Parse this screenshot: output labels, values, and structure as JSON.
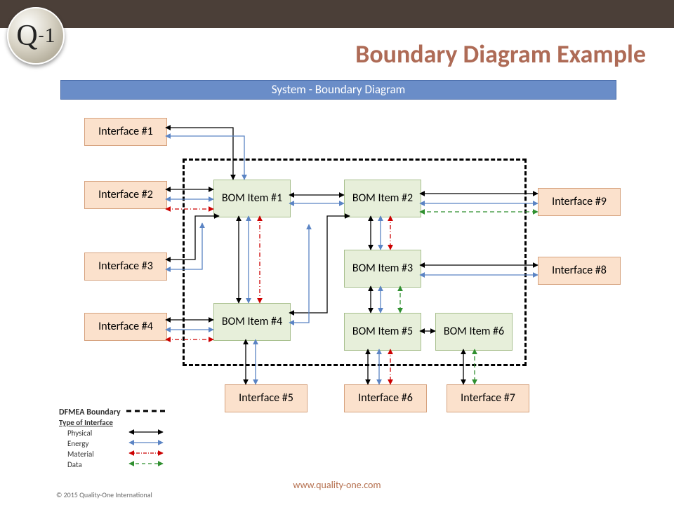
{
  "logo": {
    "q": "Q",
    "dash": "-",
    "one": "1"
  },
  "title": "Boundary Diagram Example",
  "banner": "System - Boundary Diagram",
  "interfaces": {
    "i1": "Interface #1",
    "i2": "Interface #2",
    "i3": "Interface #3",
    "i4": "Interface #4",
    "i5": "Interface #5",
    "i6": "Interface #6",
    "i7": "Interface #7",
    "i8": "Interface #8",
    "i9": "Interface #9"
  },
  "bom": {
    "b1": "BOM Item #1",
    "b2": "BOM Item #2",
    "b3": "BOM Item #3",
    "b4": "BOM Item #4",
    "b5": "BOM Item #5",
    "b6": "BOM Item #6"
  },
  "legend": {
    "boundary": "DFMEA Boundary",
    "subhead": "Type of Interface",
    "rows": {
      "physical": "Physical",
      "energy": "Energy",
      "material": "Material",
      "data": "Data"
    }
  },
  "footer": {
    "url": "www.quality-one.com",
    "copyright": "© 2015 Quality-One International"
  },
  "colors": {
    "physical": "#000000",
    "energy": "#5b84c4",
    "material": "#cc0000",
    "data": "#2f8f2f"
  }
}
